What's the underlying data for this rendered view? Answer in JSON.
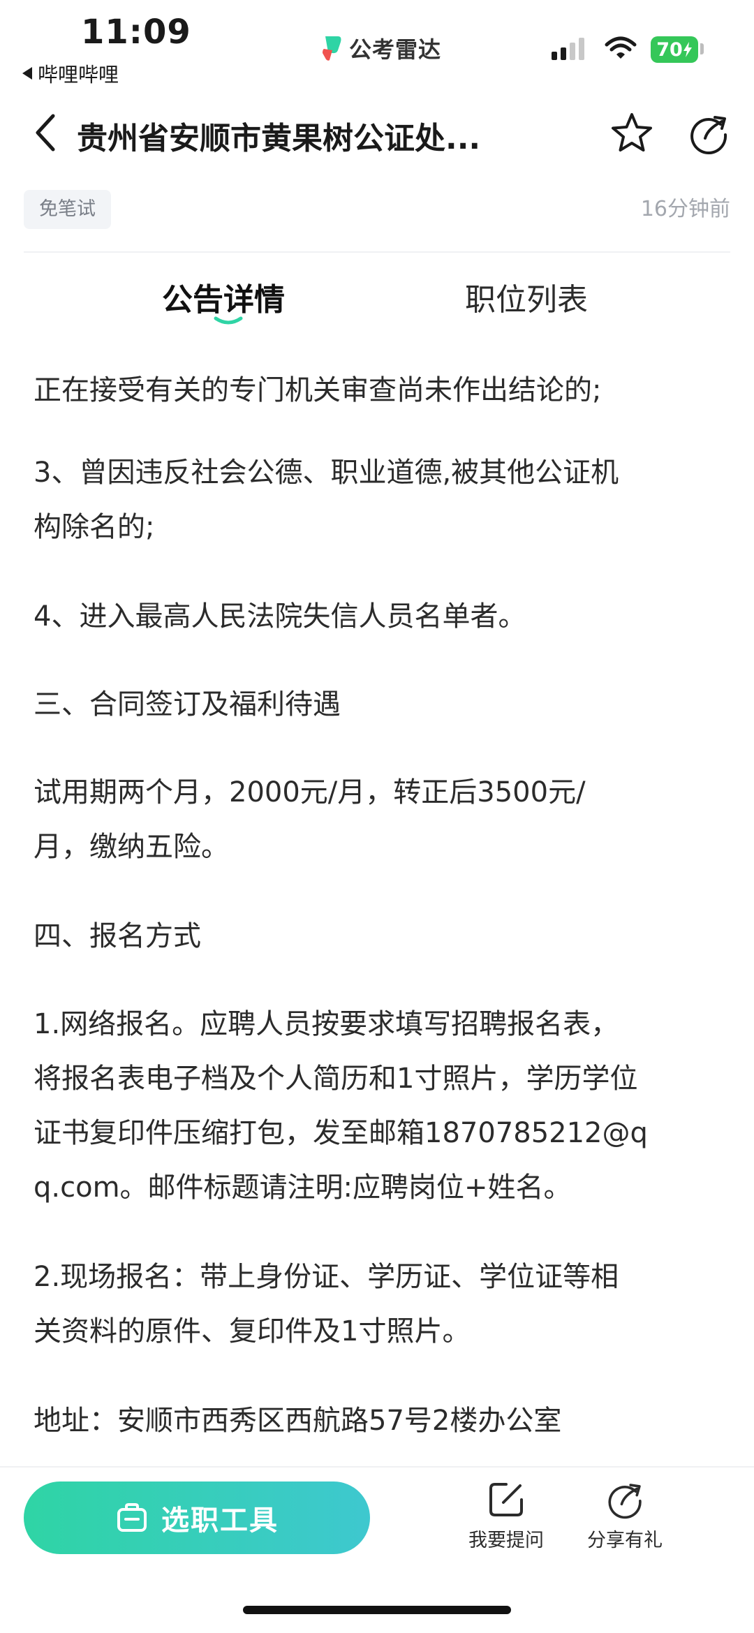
{
  "status_bar": {
    "time": "11:09",
    "back_app": "哔哩哔哩",
    "center_logo": "公考雷达",
    "battery": "70"
  },
  "header": {
    "title": "贵州省安顺市黄果树公证处...",
    "icons": [
      "chevron-left-icon",
      "star-icon",
      "share-icon"
    ]
  },
  "meta": {
    "tag": "免笔试",
    "time_ago": "16分钟前"
  },
  "tabs": [
    {
      "label": "公告详情",
      "active": true
    },
    {
      "label": "职位列表",
      "active": false
    }
  ],
  "content": {
    "cut_line": "正在接受有关的专门机关审查尚未作出结论的;",
    "paragraphs": [
      "3、曾因违反社会公德、职业道德,被其他公证机\n构除名的;",
      "4、进入最高人民法院失信人员名单者。",
      "三、合同签订及福利待遇",
      "试用期两个月，2000元/月，转正后3500元/\n月，缴纳五险。",
      "四、报名方式",
      "1.网络报名。应聘人员按要求填写招聘报名表，\n将报名表电子档及个人简历和1寸照片，学历学位\n证书复印件压缩打包，发至邮箱1870785212@q\nq.com。邮件标题请注明:应聘岗位+姓名。",
      "2.现场报名：带上身份证、学历证、学位证等相\n关资料的原件、复印件及1寸照片。",
      "地址：安顺市西秀区西航路57号2楼办公室"
    ]
  },
  "bottom_bar": {
    "cta_label": "选职工具",
    "ask_label": "我要提问",
    "share_label": "分享有礼"
  },
  "colors": {
    "accent_start": "#2fd4a5",
    "accent_end": "#3ec8cf",
    "battery": "#35c759",
    "tag_bg": "#f2f4f7"
  }
}
